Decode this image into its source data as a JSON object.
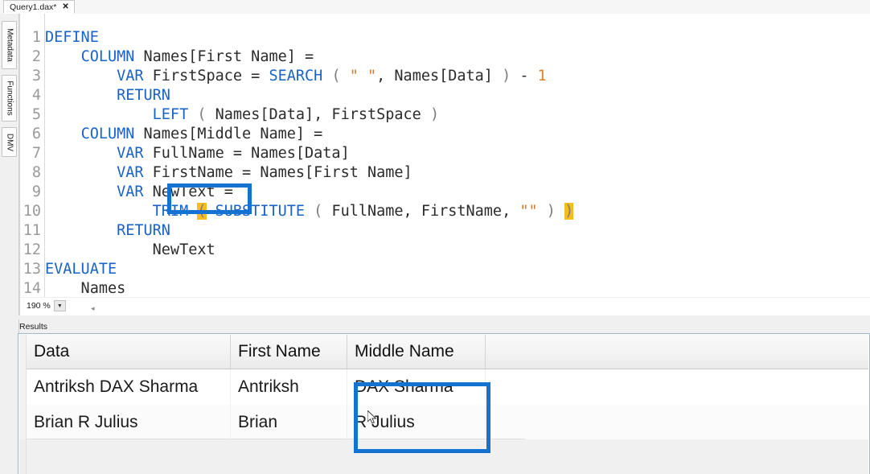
{
  "window": {
    "document_tab": {
      "title": "Query1.dax*",
      "close_icon": "close-icon"
    },
    "left_tabs": [
      {
        "label": "Metadata"
      },
      {
        "label": "Functions"
      },
      {
        "label": "DMV"
      }
    ]
  },
  "editor": {
    "zoom_level": "190 %",
    "zoom_dropdown_icon": "chevron-down-icon",
    "line_numbers": [
      "1",
      "2",
      "3",
      "4",
      "5",
      "6",
      "7",
      "8",
      "9",
      "10",
      "11",
      "12",
      "13",
      "14"
    ],
    "code_lines": [
      {
        "n": "1",
        "text": "DEFINE"
      },
      {
        "n": "2",
        "text": "    COLUMN Names[First Name] ="
      },
      {
        "n": "3",
        "text": "        VAR FirstSpace = SEARCH ( \" \", Names[Data] ) - 1"
      },
      {
        "n": "4",
        "text": "        RETURN"
      },
      {
        "n": "5",
        "text": "            LEFT ( Names[Data], FirstSpace )"
      },
      {
        "n": "6",
        "text": "    COLUMN Names[Middle Name] ="
      },
      {
        "n": "7",
        "text": "        VAR FullName = Names[Data]"
      },
      {
        "n": "8",
        "text": "        VAR FirstName = Names[First Name]"
      },
      {
        "n": "9",
        "text": "        VAR NewText ="
      },
      {
        "n": "10",
        "text": "            TRIM ( SUBSTITUTE ( FullName, FirstName, \"\" ) )"
      },
      {
        "n": "11",
        "text": "        RETURN"
      },
      {
        "n": "12",
        "text": "            NewText"
      },
      {
        "n": "13",
        "text": "EVALUATE"
      },
      {
        "n": "14",
        "text": "    Names"
      }
    ]
  },
  "results": {
    "panel_label": "Results",
    "columns": [
      "Data",
      "First Name",
      "Middle Name"
    ],
    "rows": [
      {
        "data": "Antriksh DAX Sharma",
        "first_name": "Antriksh",
        "middle_name": "DAX Sharma"
      },
      {
        "data": "Brian R Julius",
        "first_name": "Brian",
        "middle_name": "R Julius"
      }
    ]
  },
  "annotations": {
    "color": "#1472d0",
    "trim_highlight": "TRIM",
    "middle_name_highlight": "Middle Name column values"
  },
  "colors": {
    "keyword": "#1763c8",
    "function": "#1763c8",
    "string": "#cf7a2b",
    "number": "#d9832b",
    "bracket_match": "#f5bd1f",
    "annotation_blue": "#1472d0"
  }
}
